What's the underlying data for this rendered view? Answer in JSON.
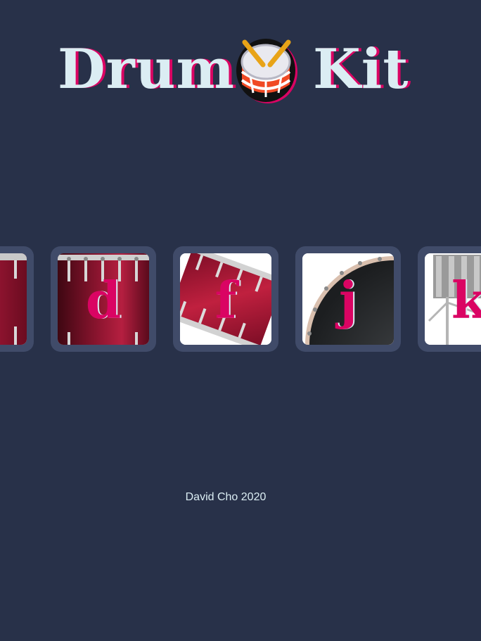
{
  "header": {
    "title_word_1": "Drum",
    "title_word_2": "Kit",
    "emoji_icon": "drum-emoji-icon"
  },
  "keys": [
    {
      "letter": "",
      "drum": "tom-drum"
    },
    {
      "letter": "d",
      "drum": "floor-tom-drum"
    },
    {
      "letter": "f",
      "drum": "snare-drum"
    },
    {
      "letter": "j",
      "drum": "bass-drum"
    },
    {
      "letter": "k",
      "drum": "cymbal-stand"
    }
  ],
  "footer": {
    "credit": "David Cho 2020"
  },
  "colors": {
    "background": "#283149",
    "key_frame": "#404b69",
    "accent": "#da0463",
    "title_text": "#dbedf3"
  }
}
